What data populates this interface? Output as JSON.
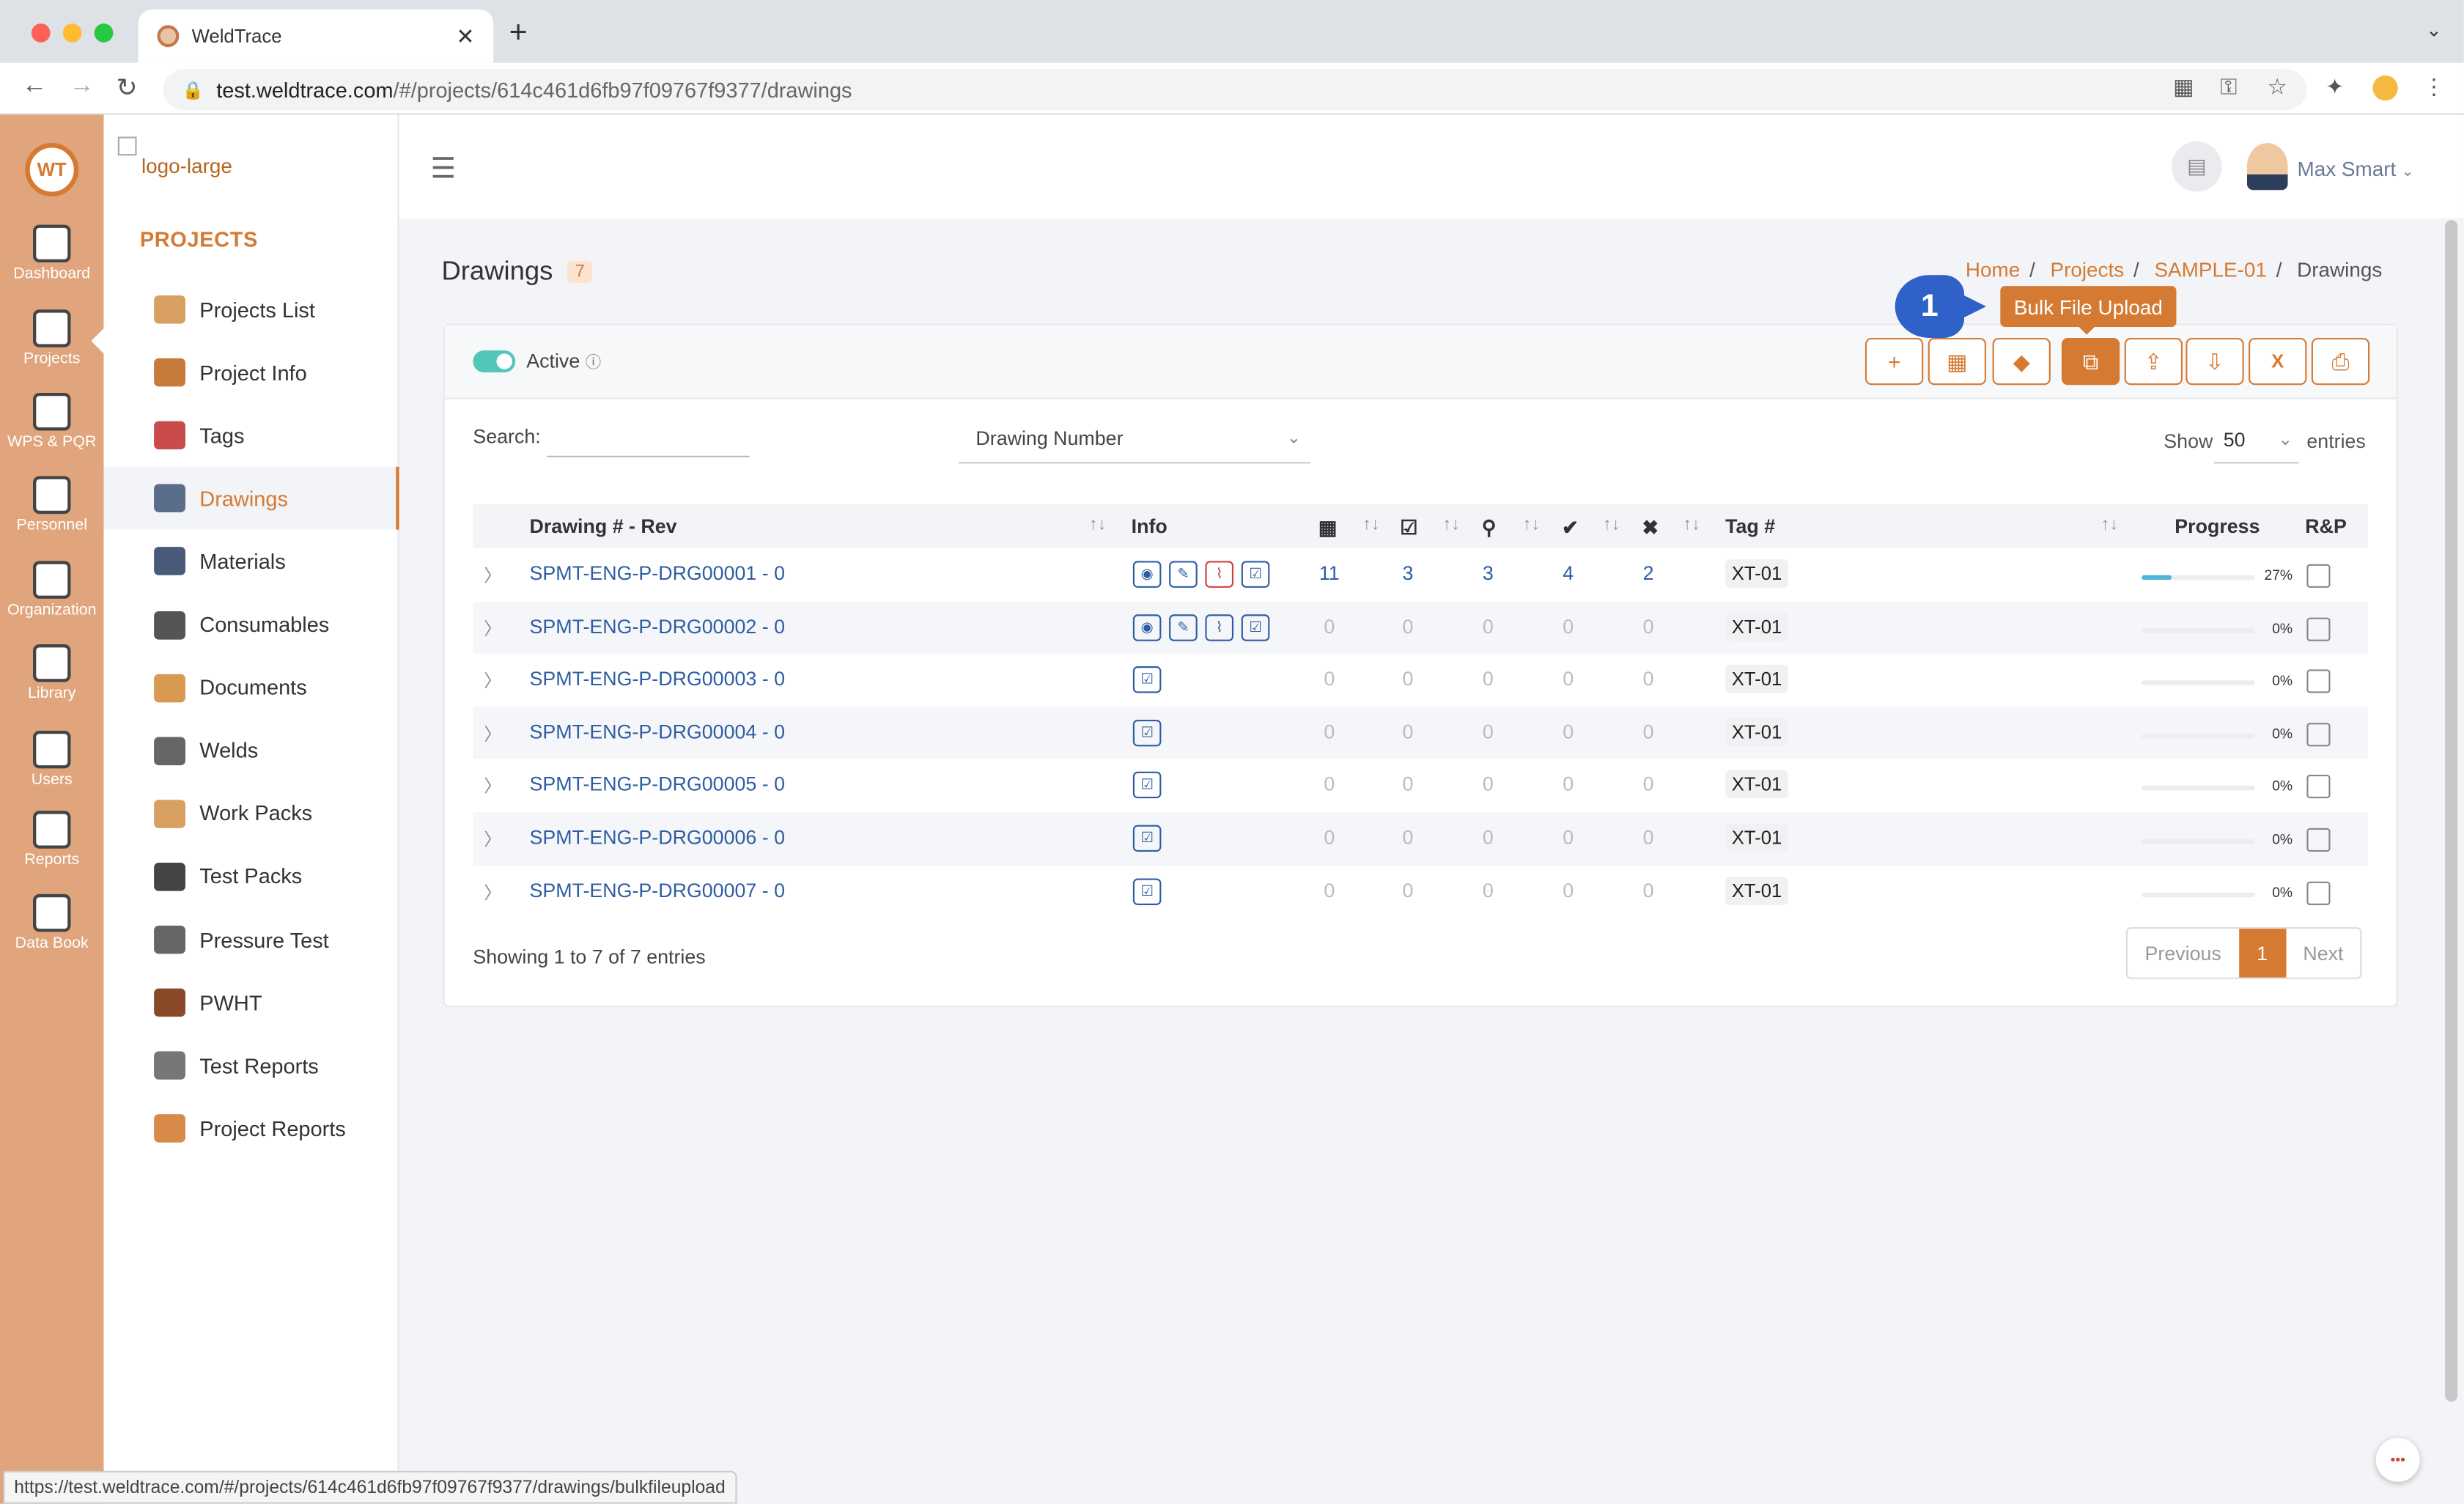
{
  "browser": {
    "tab_title": "WeldTrace",
    "url_host": "test.weldtrace.com",
    "url_path": "/#/projects/614c461d6fb97f09767f9377/drawings",
    "status_url": "https://test.weldtrace.com/#/projects/614c461d6fb97f09767f9377/drawings/bulkfileupload"
  },
  "leftbar": {
    "logo": "WT",
    "items": [
      {
        "label": "Dashboard",
        "icon": "monitor-icon"
      },
      {
        "label": "Projects",
        "icon": "folder-gear-icon"
      },
      {
        "label": "WPS & PQR",
        "icon": "clipboard-gear-icon"
      },
      {
        "label": "Personnel",
        "icon": "welder-mask-icon"
      },
      {
        "label": "Organization",
        "icon": "org-icon"
      },
      {
        "label": "Library",
        "icon": "library-icon"
      },
      {
        "label": "Users",
        "icon": "users-icon"
      },
      {
        "label": "Reports",
        "icon": "report-icon"
      },
      {
        "label": "Data Book",
        "icon": "databook-icon"
      }
    ]
  },
  "sidebar": {
    "logo_alt": "logo-large",
    "title": "PROJECTS",
    "items": [
      {
        "label": "Projects List",
        "icon": "folder-icon"
      },
      {
        "label": "Project Info",
        "icon": "gears-icon"
      },
      {
        "label": "Tags",
        "icon": "tag-icon"
      },
      {
        "label": "Drawings",
        "icon": "blueprint-icon"
      },
      {
        "label": "Materials",
        "icon": "pipes-icon"
      },
      {
        "label": "Consumables",
        "icon": "spool-icon"
      },
      {
        "label": "Documents",
        "icon": "documents-icon"
      },
      {
        "label": "Welds",
        "icon": "weld-icon"
      },
      {
        "label": "Work Packs",
        "icon": "workpack-icon"
      },
      {
        "label": "Test Packs",
        "icon": "radiation-icon"
      },
      {
        "label": "Pressure Test",
        "icon": "gauge-icon"
      },
      {
        "label": "PWHT",
        "icon": "heater-icon"
      },
      {
        "label": "Test Reports",
        "icon": "checklist-icon"
      },
      {
        "label": "Project Reports",
        "icon": "project-report-icon"
      }
    ]
  },
  "header": {
    "user_name": "Max Smart"
  },
  "page": {
    "title": "Drawings",
    "count": "7",
    "breadcrumb": [
      "Home",
      "Projects",
      "SAMPLE-01",
      "Drawings"
    ],
    "active_label": "Active",
    "tooltip": "Bulk File Upload",
    "marker": "1"
  },
  "filters": {
    "search_label": "Search:",
    "search_value": "",
    "field": "Drawing Number",
    "show_label": "Show",
    "page_size": "50",
    "entries_label": "entries"
  },
  "table": {
    "headers": {
      "drawing": "Drawing # - Rev",
      "info": "Info",
      "tag": "Tag #",
      "progress": "Progress",
      "rp": "R&P"
    },
    "rows": [
      {
        "drawing": "SPMT-ENG-P-DRG00001 - 0",
        "info": [
          "view",
          "edit",
          "attach",
          "check"
        ],
        "c1": "11",
        "c2": "3",
        "c3": "3",
        "c4": "4",
        "c5": "2",
        "tag": "XT-01",
        "progress": 27,
        "progress_label": "27%"
      },
      {
        "drawing": "SPMT-ENG-P-DRG00002 - 0",
        "info": [
          "view",
          "edit",
          "attach",
          "check"
        ],
        "c1": "0",
        "c2": "0",
        "c3": "0",
        "c4": "0",
        "c5": "0",
        "tag": "XT-01",
        "progress": 0,
        "progress_label": "0%"
      },
      {
        "drawing": "SPMT-ENG-P-DRG00003 - 0",
        "info": [
          "check"
        ],
        "c1": "0",
        "c2": "0",
        "c3": "0",
        "c4": "0",
        "c5": "0",
        "tag": "XT-01",
        "progress": 0,
        "progress_label": "0%"
      },
      {
        "drawing": "SPMT-ENG-P-DRG00004 - 0",
        "info": [
          "check"
        ],
        "c1": "0",
        "c2": "0",
        "c3": "0",
        "c4": "0",
        "c5": "0",
        "tag": "XT-01",
        "progress": 0,
        "progress_label": "0%"
      },
      {
        "drawing": "SPMT-ENG-P-DRG00005 - 0",
        "info": [
          "check"
        ],
        "c1": "0",
        "c2": "0",
        "c3": "0",
        "c4": "0",
        "c5": "0",
        "tag": "XT-01",
        "progress": 0,
        "progress_label": "0%"
      },
      {
        "drawing": "SPMT-ENG-P-DRG00006 - 0",
        "info": [
          "check"
        ],
        "c1": "0",
        "c2": "0",
        "c3": "0",
        "c4": "0",
        "c5": "0",
        "tag": "XT-01",
        "progress": 0,
        "progress_label": "0%"
      },
      {
        "drawing": "SPMT-ENG-P-DRG00007 - 0",
        "info": [
          "check"
        ],
        "c1": "0",
        "c2": "0",
        "c3": "0",
        "c4": "0",
        "c5": "0",
        "tag": "XT-01",
        "progress": 0,
        "progress_label": "0%"
      }
    ],
    "summary": "Showing 1 to 7 of 7 entries"
  },
  "pagination": {
    "previous": "Previous",
    "current": "1",
    "next": "Next"
  },
  "colors": {
    "accent": "#d57a33",
    "leftbar": "#e0a57c",
    "link": "#2f5da3",
    "toggle": "#52c7b8",
    "marker": "#2f61c9"
  }
}
